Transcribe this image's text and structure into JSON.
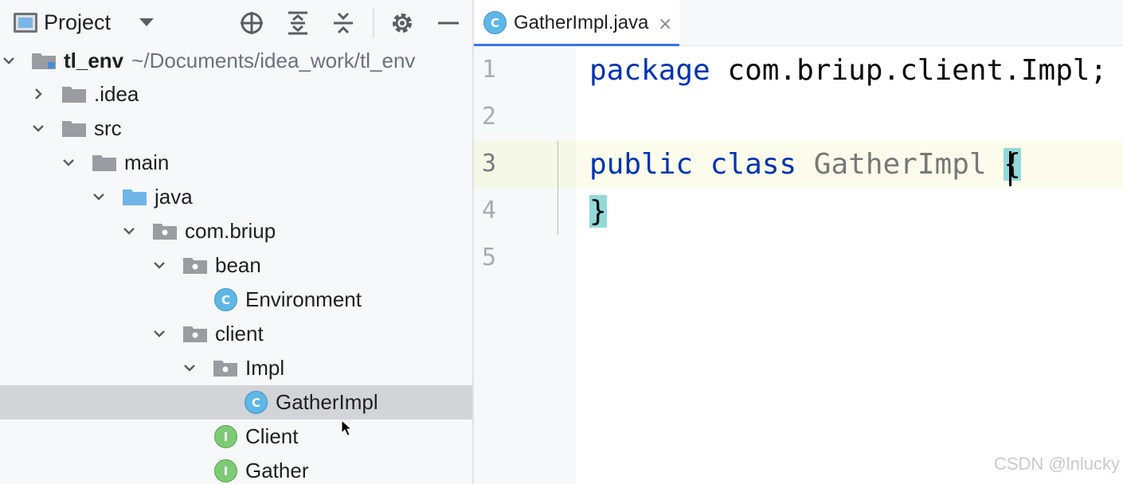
{
  "project_panel": {
    "title": "Project",
    "toolbar_icons": [
      "project-view-icon",
      "select-opened-file-icon",
      "expand-all-icon",
      "collapse-all-icon",
      "gear-icon",
      "hide-icon"
    ],
    "tree": [
      {
        "label": "tl_env",
        "path": "~/Documents/idea_work/tl_env",
        "type": "module",
        "expanded": true
      },
      {
        "label": ".idea",
        "type": "folder",
        "expanded": false
      },
      {
        "label": "src",
        "type": "folder",
        "expanded": true
      },
      {
        "label": "main",
        "type": "folder",
        "expanded": true
      },
      {
        "label": "java",
        "type": "source-folder",
        "expanded": true
      },
      {
        "label": "com.briup",
        "type": "package",
        "expanded": true
      },
      {
        "label": "bean",
        "type": "package",
        "expanded": true
      },
      {
        "label": "Environment",
        "type": "class",
        "badge": "C"
      },
      {
        "label": "client",
        "type": "package",
        "expanded": true
      },
      {
        "label": "Impl",
        "type": "package",
        "expanded": true
      },
      {
        "label": "GatherImpl",
        "type": "class",
        "badge": "C",
        "selected": true
      },
      {
        "label": "Client",
        "type": "interface",
        "badge": "I"
      },
      {
        "label": "Gather",
        "type": "interface",
        "badge": "I"
      }
    ]
  },
  "editor": {
    "tab": {
      "label": "GatherImpl.java",
      "badge": "C",
      "close": "×"
    },
    "line_numbers": [
      "1",
      "2",
      "3",
      "4",
      "5"
    ],
    "current_line": 3,
    "code": {
      "line1": {
        "kw": "package",
        "rest": " com.briup.client.Impl;"
      },
      "line3": {
        "kw1": "public",
        "kw2": "class",
        "name": "GatherImpl",
        "brace_open": "{"
      },
      "line4": {
        "brace_close": "}"
      }
    }
  },
  "watermark": "CSDN @lnlucky",
  "colors": {
    "keyword": "#0033b3",
    "class_badge": "#5fb7e6",
    "interface_badge": "#7ecb76",
    "selection": "#d2d4d8",
    "tab_underline": "#3574f0",
    "brace_match": "#93d9d9"
  }
}
